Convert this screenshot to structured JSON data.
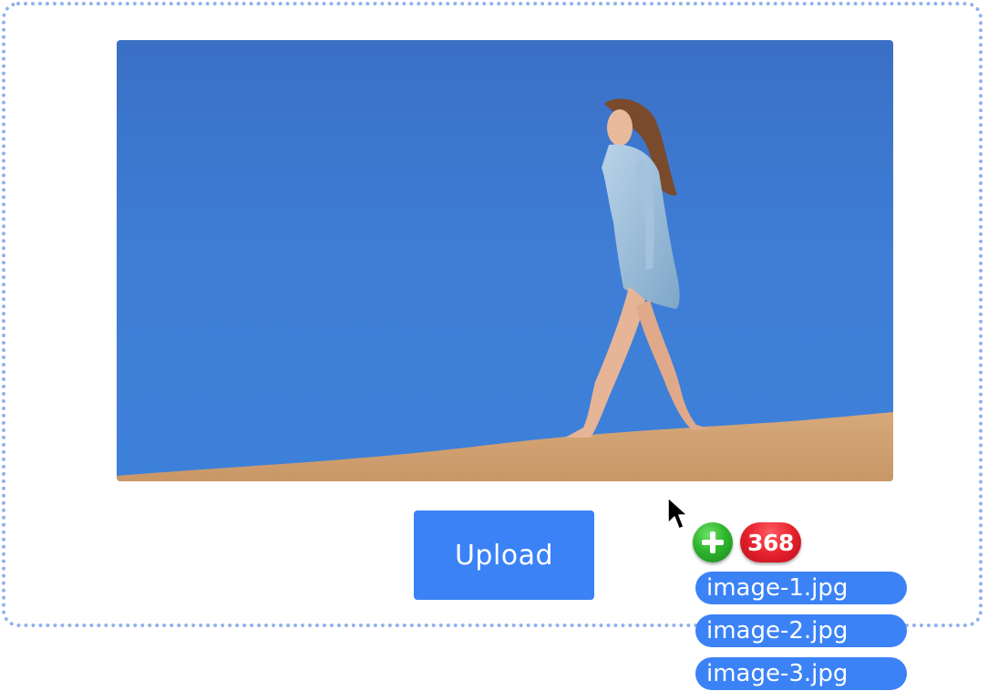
{
  "upload": {
    "button_label": "Upload"
  },
  "drag": {
    "plus_icon": "plus-circle-icon",
    "count": "368",
    "files": [
      {
        "name": "image-1.jpg"
      },
      {
        "name": "image-2.jpg"
      },
      {
        "name": "image-3.jpg"
      }
    ]
  },
  "preview": {
    "alt": "woman-walking-on-sand-dune-photo"
  },
  "colors": {
    "accent": "#3b82f6",
    "dropzone_border": "#8fb2ee",
    "badge_green": "#2fb52d",
    "badge_red": "#e3202c"
  }
}
